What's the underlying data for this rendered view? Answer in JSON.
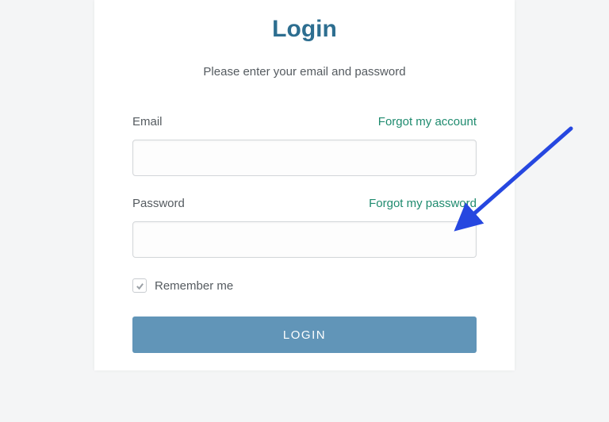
{
  "title": "Login",
  "subtitle": "Please enter your email and password",
  "email": {
    "label": "Email",
    "forgot_link": "Forgot my account",
    "value": ""
  },
  "password": {
    "label": "Password",
    "forgot_link": "Forgot my password",
    "value": ""
  },
  "remember": {
    "label": "Remember me",
    "checked": true
  },
  "login_button": "LOGIN",
  "annotation": {
    "arrow_color": "#2647e0"
  }
}
